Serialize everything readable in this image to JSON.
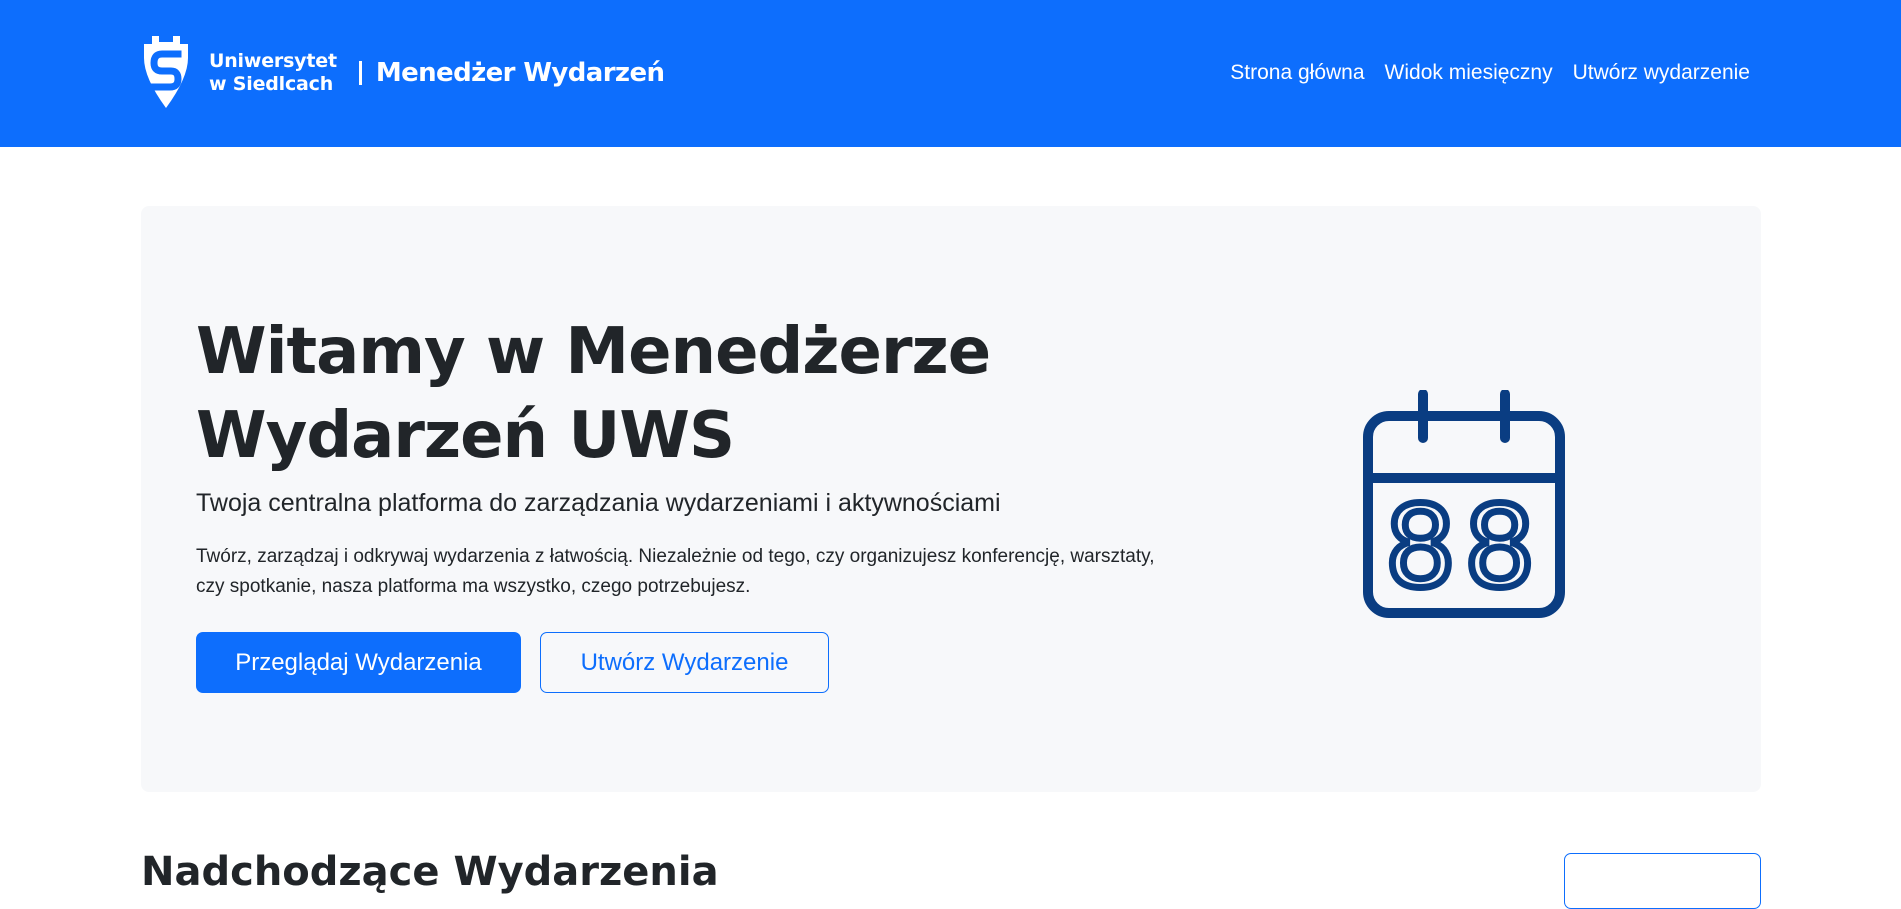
{
  "colors": {
    "primary": "#0d6efd",
    "hero_bg": "#f7f8fa",
    "icon": "#0a3d82",
    "text": "#212529"
  },
  "navbar": {
    "university_line1": "Uniwersytet",
    "university_line2": "w Siedlcach",
    "app_name": "Menedżer Wydarzeń",
    "logo_icon": "university-logo-icon",
    "links": [
      {
        "label": "Strona główna"
      },
      {
        "label": "Widok miesięczny"
      },
      {
        "label": "Utwórz wydarzenie"
      }
    ]
  },
  "hero": {
    "title_line1": "Witamy w Menedżerze",
    "title_line2": "Wydarzeń UWS",
    "lead": "Twoja centralna platforma do zarządzania wydarzeniami i aktywnościami",
    "text": "Twórz, zarządzaj i odkrywaj wydarzenia z łatwością. Niezależnie od tego, czy organizujesz konferencję, warsztaty, czy spotkanie, nasza platforma ma wszystko, czego potrzebujesz.",
    "primary_button": "Przeglądaj Wydarzenia",
    "secondary_button": "Utwórz Wydarzenie",
    "calendar_icon": "calendar-icon",
    "calendar_number": "88"
  },
  "upcoming": {
    "title": "Nadchodzące Wydarzenia"
  }
}
